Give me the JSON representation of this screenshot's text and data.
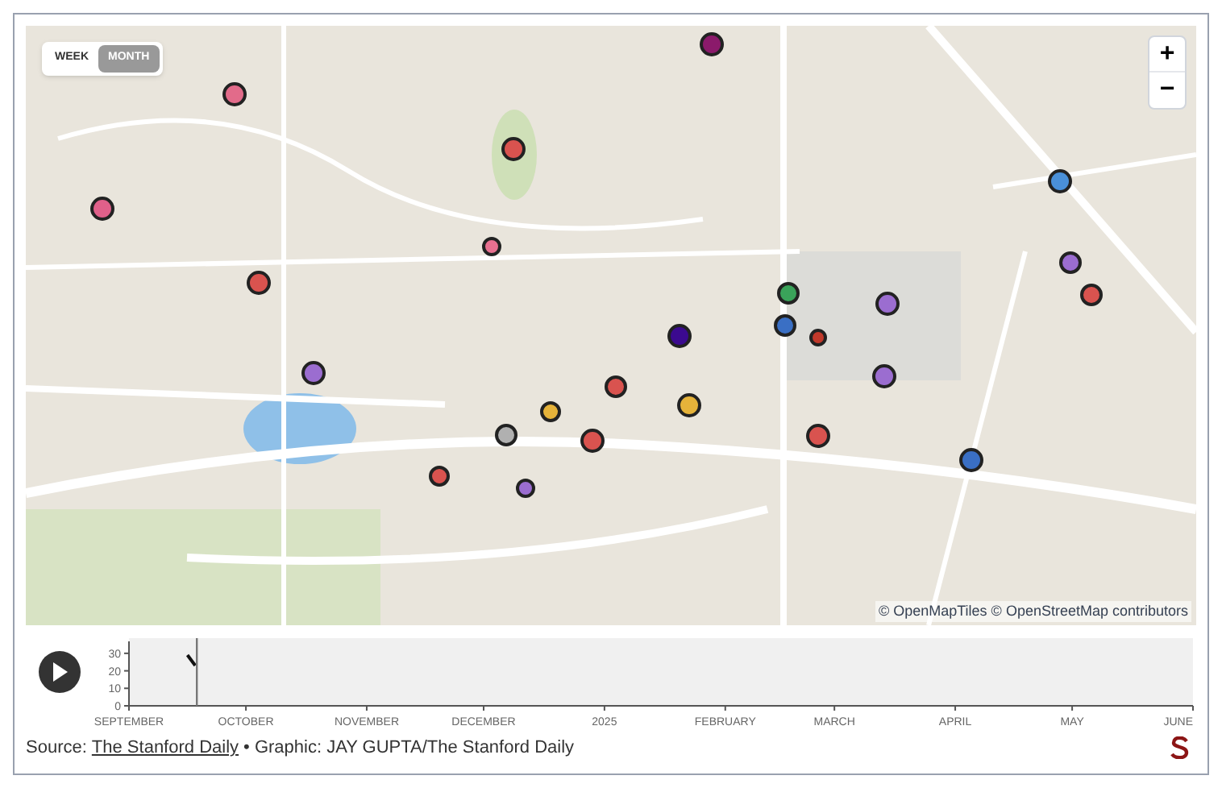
{
  "toggle": [
    {
      "label": "WEEK",
      "selected": false
    },
    {
      "label": "MONTH",
      "selected": true
    }
  ],
  "zoom": {
    "in": "+",
    "out": "−"
  },
  "pins": [
    {
      "color": "#8b1a6b"
    },
    {
      "color": "#e26b8a"
    },
    {
      "color": "#d9534f"
    },
    {
      "color": "#e0608a"
    },
    {
      "color": "#e87090"
    },
    {
      "color": "#d9534f"
    },
    {
      "color": "#4a90d9"
    },
    {
      "color": "#9b6dd0"
    },
    {
      "color": "#d9534f"
    },
    {
      "color": "#3aa35a"
    },
    {
      "color": "#9b6dd0"
    },
    {
      "color": "#3a6fc4"
    },
    {
      "color": "#c0392b"
    },
    {
      "color": "#3b0a8f"
    },
    {
      "color": "#9b6dd0"
    },
    {
      "color": "#9b6dd0"
    },
    {
      "color": "#d9534f"
    },
    {
      "color": "#e6b33a"
    },
    {
      "color": "#e6b33a"
    },
    {
      "color": "#b0b0b0"
    },
    {
      "color": "#d9534f"
    },
    {
      "color": "#d9534f"
    },
    {
      "color": "#3a6fc4"
    },
    {
      "color": "#d9534f"
    },
    {
      "color": "#9b6dd0"
    }
  ],
  "attribution": "© OpenMapTiles © OpenStreetMap contributors",
  "timeline": {
    "chart_data": {
      "type": "line",
      "x": [
        "2024-09-16",
        "2024-09-18"
      ],
      "series": [
        {
          "color": "#111111",
          "values": [
            29,
            23
          ]
        }
      ],
      "xlim": [
        "2024-09-01",
        "2025-06-01"
      ],
      "ylim": [
        0,
        35
      ],
      "ref_lines": [
        {
          "axis": "x",
          "value": "2024-09-18"
        }
      ],
      "xticks": [
        {
          "value": "2024-09-01",
          "label": "SEPTEMBER"
        },
        {
          "value": "2024-10-01",
          "label": "OCTOBER"
        },
        {
          "value": "2024-11-01",
          "label": "NOVEMBER"
        },
        {
          "value": "2024-12-01",
          "label": "DECEMBER"
        },
        {
          "value": "2025-01-01",
          "label": "2025"
        },
        {
          "value": "2025-02-01",
          "label": "FEBRUARY"
        },
        {
          "value": "2025-03-01",
          "label": "MARCH"
        },
        {
          "value": "2025-04-01",
          "label": "APRIL"
        },
        {
          "value": "2025-05-01",
          "label": "MAY"
        },
        {
          "value": "2025-06-01",
          "label": "JUNE"
        }
      ],
      "yticks": [
        0,
        10,
        20,
        30
      ]
    }
  },
  "footer": {
    "source_label": "Source:",
    "source_link": "The Stanford Daily",
    "credit": "• Graphic: JAY GUPTA/The Stanford Daily"
  }
}
